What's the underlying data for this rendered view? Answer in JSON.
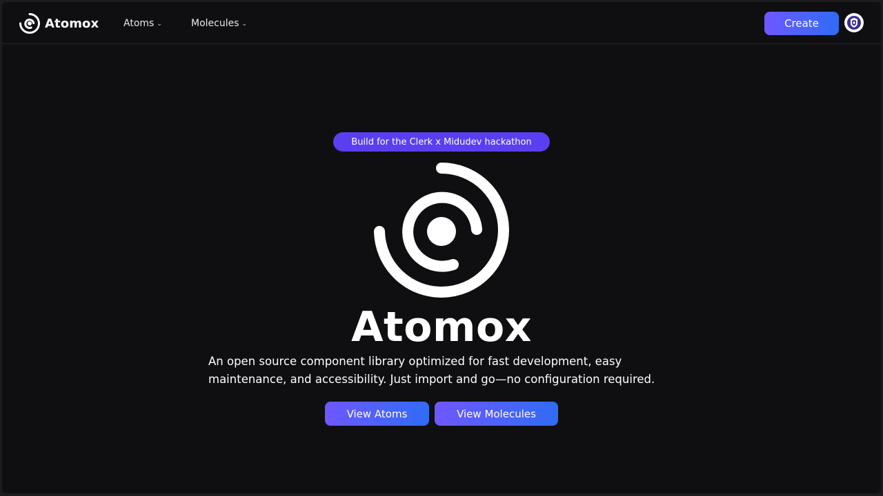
{
  "brand": {
    "name": "Atomox",
    "icon": "atom-logo-icon"
  },
  "nav": {
    "links": [
      {
        "label": "Atoms",
        "icon": "chevron-down-icon"
      },
      {
        "label": "Molecules",
        "icon": "chevron-down-icon"
      }
    ],
    "create_label": "Create",
    "avatar_icon": "user-avatar-icon"
  },
  "hero": {
    "badge": "Build for the Clerk x Midudev hackathon",
    "logo_icon": "atom-logo-icon",
    "title": "Atomox",
    "description": "An open source component library optimized for fast development, easy maintenance, and accessibility. Just import and go—no configuration required.",
    "buttons": {
      "atoms_label": "View Atoms",
      "molecules_label": "View Molecules"
    }
  },
  "colors": {
    "background": "#0f0f11",
    "accent_start": "#6f57ff",
    "accent_end": "#2f6cf5",
    "badge": "#5a3ff0",
    "text": "#ffffff"
  }
}
